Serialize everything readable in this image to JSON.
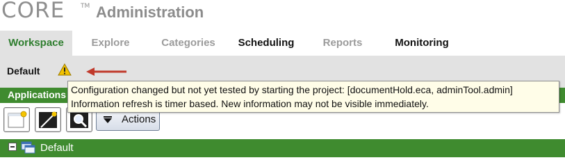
{
  "header": {
    "brand": "CORE",
    "trademark": "TM",
    "title": "Administration"
  },
  "tabs": [
    {
      "label": "Workspace",
      "active": true
    },
    {
      "label": "Explore",
      "active": false
    },
    {
      "label": "Categories",
      "active": false
    },
    {
      "label": "Scheduling",
      "active": false
    },
    {
      "label": "Reports",
      "active": false
    },
    {
      "label": "Monitoring",
      "active": false
    }
  ],
  "subbar": {
    "project_name": "Default",
    "warning_icon": "warning-triangle-icon",
    "pointer_icon": "red-arrow-icon"
  },
  "applications": {
    "header_label": "Applications"
  },
  "toolbar": {
    "buttons": [
      "new-application-icon",
      "edit-application-icon",
      "search-application-icon"
    ],
    "actions_label": "Actions"
  },
  "tree": {
    "root_label": "Default"
  },
  "tooltip": {
    "line1": "Configuration changed but not yet tested by starting the project: [documentHold.eca, adminTool.admin]",
    "line2": "Information refresh is timer based. New information may not be visible immediately."
  },
  "colors": {
    "accent_green": "#3f8b2f",
    "active_tab_text": "#2e7d2e",
    "warning_yellow": "#f2c200",
    "arrow_red": "#c0392b",
    "tooltip_bg": "#fffde8"
  }
}
